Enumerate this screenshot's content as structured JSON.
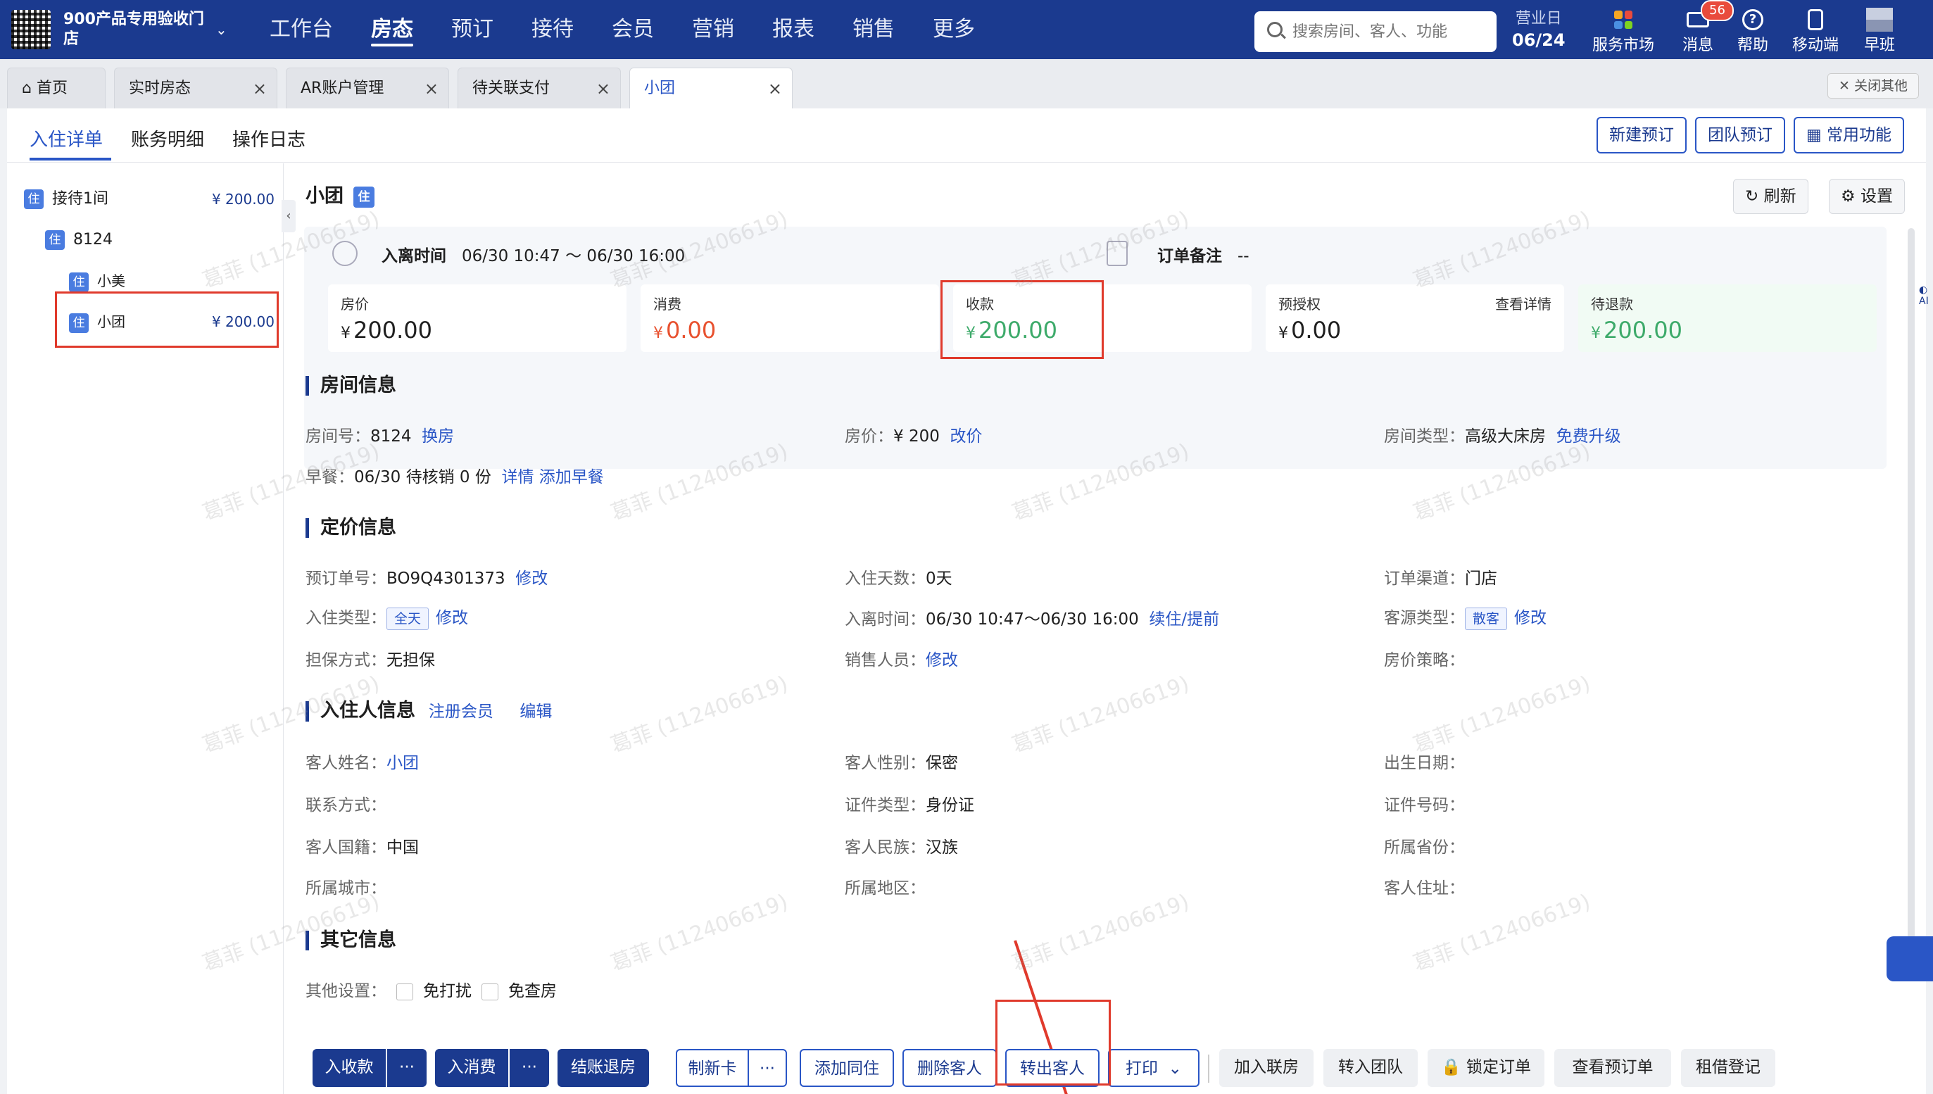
{
  "store": {
    "name": "900产品专用验收门店"
  },
  "nav": [
    "工作台",
    "房态",
    "预订",
    "接待",
    "会员",
    "营销",
    "报表",
    "销售",
    "更多"
  ],
  "nav_active": 1,
  "search": {
    "placeholder": "搜索房间、客人、功能"
  },
  "bizday": {
    "label": "营业日",
    "date": "06/24"
  },
  "top_icons": {
    "market": "服务市场",
    "messages": "消息",
    "msg_count": "56",
    "help": "帮助",
    "mobile": "移动端",
    "shift": "早班"
  },
  "tabs": [
    "首页",
    "实时房态",
    "AR账户管理",
    "待关联支付",
    "小团"
  ],
  "close_others": "✕ 关闭其他",
  "subtabs": [
    "入住详单",
    "账务明细",
    "操作日志"
  ],
  "header_buttons": {
    "new_booking": "新建预订",
    "group_booking": "团队预订",
    "common": "常用功能"
  },
  "tree": {
    "root": {
      "label": "接待1间",
      "amount": "¥ 200.00"
    },
    "room": "8124",
    "guests": [
      {
        "name": "小美",
        "amount": ""
      },
      {
        "name": "小团",
        "amount": "¥ 200.00"
      }
    ]
  },
  "zhu_badge": "住",
  "guest_title": "小团",
  "actions": {
    "refresh": "刷新",
    "settings": "设置"
  },
  "stay": {
    "label": "入离时间",
    "value": "06/30 10:47 ～ 06/30 16:00",
    "note_label": "订单备注",
    "note_value": "--"
  },
  "cards": [
    {
      "title": "房价",
      "value": "200.00",
      "currency": "¥"
    },
    {
      "title": "消费",
      "value": "0.00",
      "currency": "¥"
    },
    {
      "title": "收款",
      "value": "200.00",
      "currency": "¥"
    },
    {
      "title": "预授权",
      "value": "0.00",
      "currency": "¥",
      "link": "查看详情"
    },
    {
      "title": "待退款",
      "value": "200.00",
      "currency": "¥"
    }
  ],
  "sections": {
    "room": "房间信息",
    "price": "定价信息",
    "guest": "入住人信息",
    "other": "其它信息"
  },
  "room_info": {
    "room_no_k": "房间号：",
    "room_no": "8124",
    "change_room": "换房",
    "price_k": "房价：",
    "price": "¥ 200",
    "change_price": "改价",
    "type_k": "房间类型：",
    "type": "高级大床房",
    "upgrade": "免费升级",
    "breakfast_k": "早餐：",
    "breakfast": "06/30 待核销 0 份",
    "bf_detail": "详情",
    "bf_add": "添加早餐"
  },
  "price_info": {
    "order_no_k": "预订单号：",
    "order_no": "BO9Q4301373",
    "order_edit": "修改",
    "days_k": "入住天数：",
    "days": "0天",
    "channel_k": "订单渠道：",
    "channel": "门店",
    "stay_type_k": "入住类型：",
    "stay_type": "全天",
    "stay_type_edit": "修改",
    "inout_k": "入离时间：",
    "inout": "06/30 10:47～06/30 16:00",
    "extend": "续住/提前",
    "source_k": "客源类型：",
    "source": "散客",
    "source_edit": "修改",
    "guarantee_k": "担保方式：",
    "guarantee": "无担保",
    "sales_k": "销售人员：",
    "sales_edit": "修改",
    "policy_k": "房价策略："
  },
  "guest_links": {
    "register": "注册会员",
    "edit": "编辑"
  },
  "guest_info": {
    "name_k": "客人姓名：",
    "name": "小团",
    "gender_k": "客人性别：",
    "gender": "保密",
    "birth_k": "出生日期：",
    "contact_k": "联系方式：",
    "idtype_k": "证件类型：",
    "idtype": "身份证",
    "idno_k": "证件号码：",
    "nation_k": "客人国籍：",
    "nation": "中国",
    "ethnic_k": "客人民族：",
    "ethnic": "汉族",
    "province_k": "所属省份：",
    "city_k": "所属城市：",
    "district_k": "所属地区：",
    "address_k": "客人住址："
  },
  "other_info": {
    "k": "其他设置：",
    "opt1": "免打扰",
    "opt2": "免查房"
  },
  "bottom": {
    "receive": "入收款",
    "consume": "入消费",
    "checkout": "结账退房",
    "newcard": "制新卡",
    "more": "···",
    "add_companion": "添加同住",
    "delete_guest": "删除客人",
    "transfer_out": "转出客人",
    "print": "打印",
    "join_linked": "加入联房",
    "to_group": "转入团队",
    "lock_order": "锁定订单",
    "view_booking": "查看预订单",
    "rental": "租借登记"
  },
  "watermark": "葛菲 (112406619)",
  "colors": {
    "brand": "#1b3a8f",
    "link": "#2a56c6",
    "highlight": "#e03a2c",
    "refund": "#3daa6a",
    "consume": "#e8512f"
  }
}
